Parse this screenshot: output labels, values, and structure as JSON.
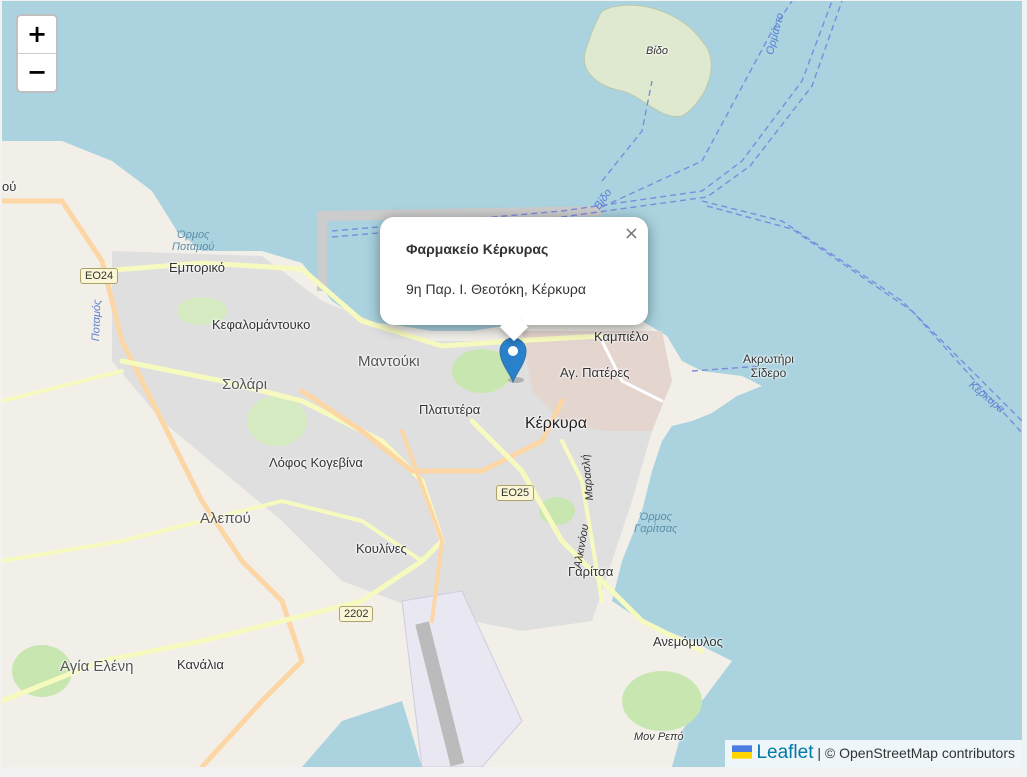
{
  "zoom": {
    "in_label": "+",
    "out_label": "−"
  },
  "popup": {
    "title": "Φαρμακείο Κέρκυρας",
    "address": "9η Παρ. Ι. Θεοτόκη, Κέρκυρα",
    "close_label": "×"
  },
  "attribution": {
    "leaflet": "Leaflet",
    "separator": "|",
    "osm": "© OpenStreetMap contributors"
  },
  "map_labels": {
    "vido": "Βίδο",
    "ormos_potamou": "Όρμος\nΠοταμού",
    "emporiko": "Εμπορικό",
    "kefalomantouko": "Κεφαλομάντουκο",
    "mantouki": "Μαντούκι",
    "solari": "Σολάρι",
    "kampiello": "Καμπιέλο",
    "ag_pateres": "Αγ. Πατέρες",
    "akrotirio_sidero": "Ακρωτήρι\nΣίδερο",
    "platytera": "Πλατυτέρα",
    "kerkyra": "Κέρκυρα",
    "lofos_kogevina": "Λόφος Κογεβίνα",
    "alepou": "Αλεπού",
    "koulines": "Κουλίνες",
    "ormos_garitsas": "Όρμος\nΓαρίτσας",
    "garitsa": "Γαρίτσα",
    "anemomylos": "Ανεμόμυλος",
    "agia_eleni": "Αγία Ελένη",
    "kanalia": "Κανάλια",
    "mon_repo": "Μον Ρεπό",
    "potamos": "Ποταμός",
    "marasli": "Μαρασλή",
    "alkinoou": "Αλκινόου",
    "ferry1": "Ορμάντο",
    "ferry2": "Βίδο",
    "ferry3": "Κέρκυρα",
    "edge_ou": "ού"
  },
  "road_shields": {
    "eo24": "EO24",
    "eo25": "EO25",
    "r2202": "2202"
  },
  "colors": {
    "sea": "#aad3df",
    "land": "#f2efe9",
    "urban": "#e0dfdf",
    "park": "#c8e6b0",
    "primary_road": "#fcd6a4",
    "secondary_road": "#f7fabf",
    "marker": "#2a81cb",
    "leaflet_link": "#0078a8",
    "ferry_line": "#7b8cde"
  }
}
